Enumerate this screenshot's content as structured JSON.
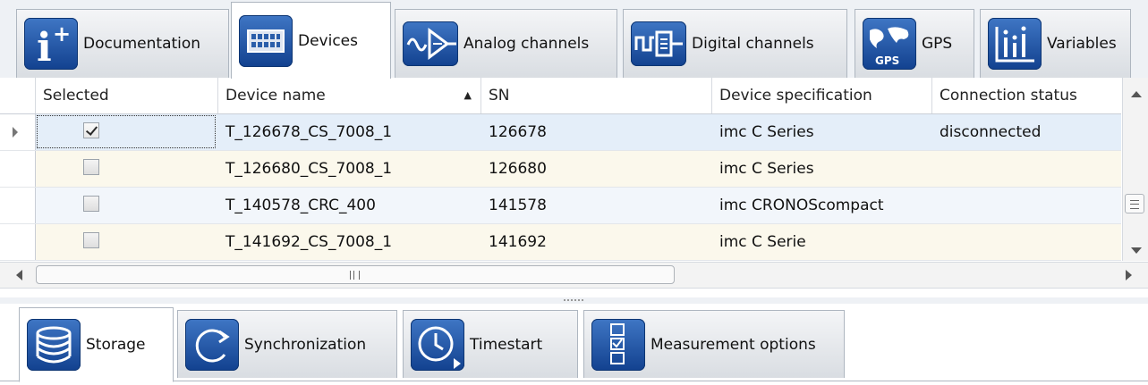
{
  "top_tabs": [
    {
      "label": "Documentation",
      "icon": "info-icon"
    },
    {
      "label": "Devices",
      "icon": "devices-icon"
    },
    {
      "label": "Analog channels",
      "icon": "analog-channels-icon"
    },
    {
      "label": "Digital channels",
      "icon": "digital-channels-icon"
    },
    {
      "label": "GPS",
      "icon": "gps-icon",
      "icon_caption": "GPS"
    },
    {
      "label": "Variables",
      "icon": "variables-icon"
    }
  ],
  "active_top_tab": "Devices",
  "grid": {
    "columns": [
      "Selected",
      "Device name",
      "SN",
      "Device specification",
      "Connection status"
    ],
    "sort_column": "Device name",
    "sort_direction": "ascending",
    "rows": [
      {
        "selected": true,
        "name": "T_126678_CS_7008_1",
        "sn": "126678",
        "spec": "imc C Series",
        "status": "disconnected"
      },
      {
        "selected": false,
        "name": "T_126680_CS_7008_1",
        "sn": "126680",
        "spec": "imc C Series",
        "status": ""
      },
      {
        "selected": false,
        "name": "T_140578_CRC_400",
        "sn": "141578",
        "spec": "imc CRONOScompact",
        "status": ""
      },
      {
        "selected": false,
        "name": "T_141692_CS_7008_1",
        "sn": "141692",
        "spec": "imc C Serie",
        "status": ""
      }
    ]
  },
  "bottom_tabs": [
    {
      "label": "Storage",
      "icon": "storage-icon"
    },
    {
      "label": "Synchronization",
      "icon": "synchronization-icon"
    },
    {
      "label": "Timestart",
      "icon": "clock-icon"
    },
    {
      "label": "Measurement options",
      "icon": "checklist-icon"
    }
  ],
  "active_bottom_tab": "Storage",
  "colors": {
    "icon_blue": "#2a5eaa",
    "selected_row": "#e4eef9",
    "alt_row": "#fbf8ec"
  }
}
